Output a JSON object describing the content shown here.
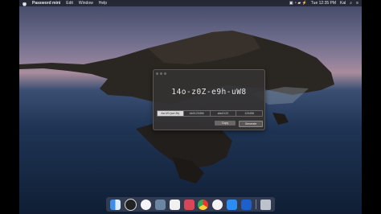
{
  "menubar": {
    "app_name": "Password mini",
    "items": [
      "Edit",
      "Window",
      "Help"
    ],
    "clock": "Tue 12:35 PM",
    "user": "Kal"
  },
  "window": {
    "password": "14o-z0Z-e9h-uW8",
    "segments": [
      "Aa 0/0 (cut 2b)",
      "Ab0123456",
      "abc0123",
      "123456"
    ],
    "selected_segment": 0,
    "copy_label": "Copy",
    "generate_label": "Generate"
  },
  "dock": {
    "icons": [
      "finder-icon",
      "clock-icon",
      "music-icon",
      "preview-icon",
      "photos-icon",
      "affinity-icon",
      "chrome-icon",
      "podcasts-icon",
      "appstore-icon",
      "password-mini-icon",
      "trash-icon"
    ]
  }
}
